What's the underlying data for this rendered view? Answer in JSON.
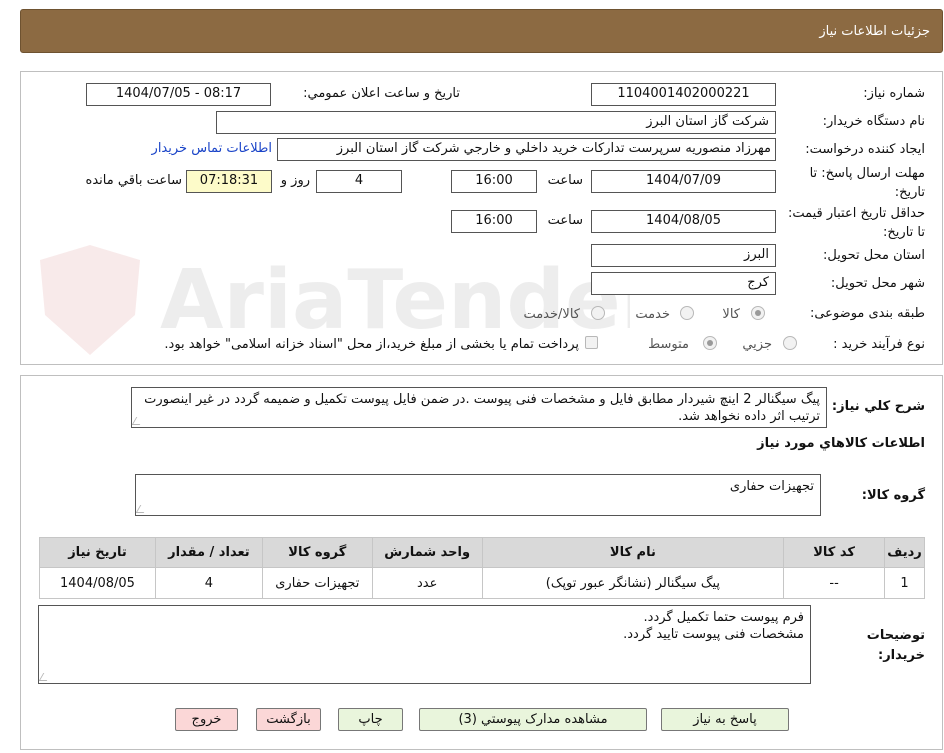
{
  "header": {
    "title": "جزئیات اطلاعات نیاز"
  },
  "form": {
    "need_number_label": "شماره نیاز:",
    "need_number": "1104001402000221",
    "announce_label": "تاریخ و ساعت اعلان عمومي:",
    "announce_value": "1404/07/05 - 08:17",
    "buyer_org_label": "نام دستگاه خريدار:",
    "buyer_org": "شرکت گاز استان البرز",
    "creator_label": "ايجاد کننده درخواست:",
    "creator": "مهرزاد منصوريه سرپرست تداركات خريد داخلي و خارجي شركت گاز استان البرز",
    "contact_link": "اطلاعات تماس خريدار",
    "send_deadline_label": "مهلت ارسال پاسخ: تا تاریخ:",
    "send_date": "1404/07/09",
    "time_label": "ساعت",
    "send_time": "16:00",
    "days": "4",
    "days_label": "روز و",
    "remaining_time": "07:18:31",
    "remaining_label": "ساعت باقي مانده",
    "validity_label": "حداقل تاريخ اعتبار قيمت: تا تاریخ:",
    "validity_date": "1404/08/05",
    "validity_time": "16:00",
    "province_label": "استان محل تحويل:",
    "province": "البرز",
    "city_label": "شهر محل تحويل:",
    "city": "کرج",
    "category_label": "طبقه بندی موضوعی:",
    "category_options": [
      "کالا",
      "خدمت",
      "کالا/خدمت"
    ],
    "process_label": "نوع فرآيند خريد :",
    "process_options": [
      "جزيي",
      "متوسط"
    ],
    "payment_note": "پرداخت تمام يا بخشی از مبلغ خريد،از محل \"اسناد خزانه اسلامی\" خواهد بود."
  },
  "description": {
    "label": "شرح کلي نياز:",
    "text": "پیگ سیگنالر 2 اینچ شیردار مطابق فایل و مشخصات فنی پیوست .در ضمن فایل پیوست تکمیل و ضمیمه گردد در غیر اینصورت ترتیب اثر داده نخواهد شد."
  },
  "goods": {
    "section_title": "اطلاعات کالاهاي مورد نياز",
    "group_label": "گروه کالا:",
    "group_value": "تجهیزات حفاری",
    "columns": [
      "رديف",
      "کد کالا",
      "نام کالا",
      "واحد شمارش",
      "گروه کالا",
      "تعداد / مقدار",
      "تاریخ نیاز"
    ],
    "rows": [
      [
        "1",
        "--",
        "پیگ سیگنالر (نشانگر عبور توپک)",
        "عدد",
        "تجهیزات حفاری",
        "4",
        "1404/08/05"
      ]
    ]
  },
  "buyer_notes": {
    "label": "توضيحات خريدار:",
    "lines": [
      "فرم پیوست حتما تکمیل گردد.",
      "مشخصات فنی پیوست تایید گردد."
    ]
  },
  "buttons": {
    "reply": "پاسخ به نياز",
    "attachments": "مشاهده مدارک پيوستي (3)",
    "print": "چاپ",
    "back": "بازگشت",
    "exit": "خروج"
  },
  "watermark": {
    "text": "AriaTender.neT"
  },
  "colors": {
    "header_bg": "#8c6a42",
    "button_green": "#e9f5dc",
    "button_pink": "#fbd7d7",
    "timer_bg": "#fdfbc9",
    "link": "#1a44c8"
  }
}
